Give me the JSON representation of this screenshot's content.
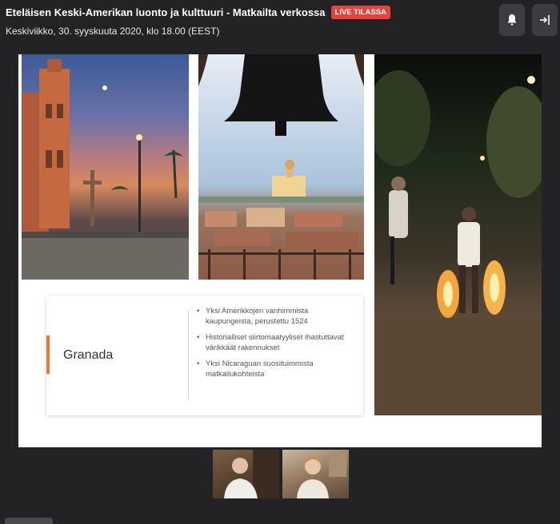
{
  "header": {
    "event_title": "Eteläisen Keski-Amerikan luonto ja kulttuuri - Matkailta verkossa",
    "live_badge": "LIVE TILASSA",
    "event_datetime": "Keskiviikko, 30. syyskuuta 2020, klo 18.00 (EEST)",
    "bell_icon": "bell-icon",
    "exit_icon": "exit-icon"
  },
  "slide": {
    "photos": [
      "cathedral-plaza-photo",
      "bell-tower-view-photo",
      "fire-festival-photo"
    ],
    "city": "Granada",
    "bullets": [
      "Yksi Amerikkojen vanhimmista kaupungeista, perustettu 1524",
      "Historialliset siirtomaatyyliset ihastuttavat värikkäät rakennukset",
      "Yksi Nicaraguan suosituimmista matkailukohteista"
    ],
    "accent_color": "#e57a35"
  },
  "participants": [
    "participant-video-1",
    "participant-video-2"
  ],
  "colors": {
    "background": "#232326",
    "live": "#e3443f",
    "button": "#3c3c40"
  }
}
